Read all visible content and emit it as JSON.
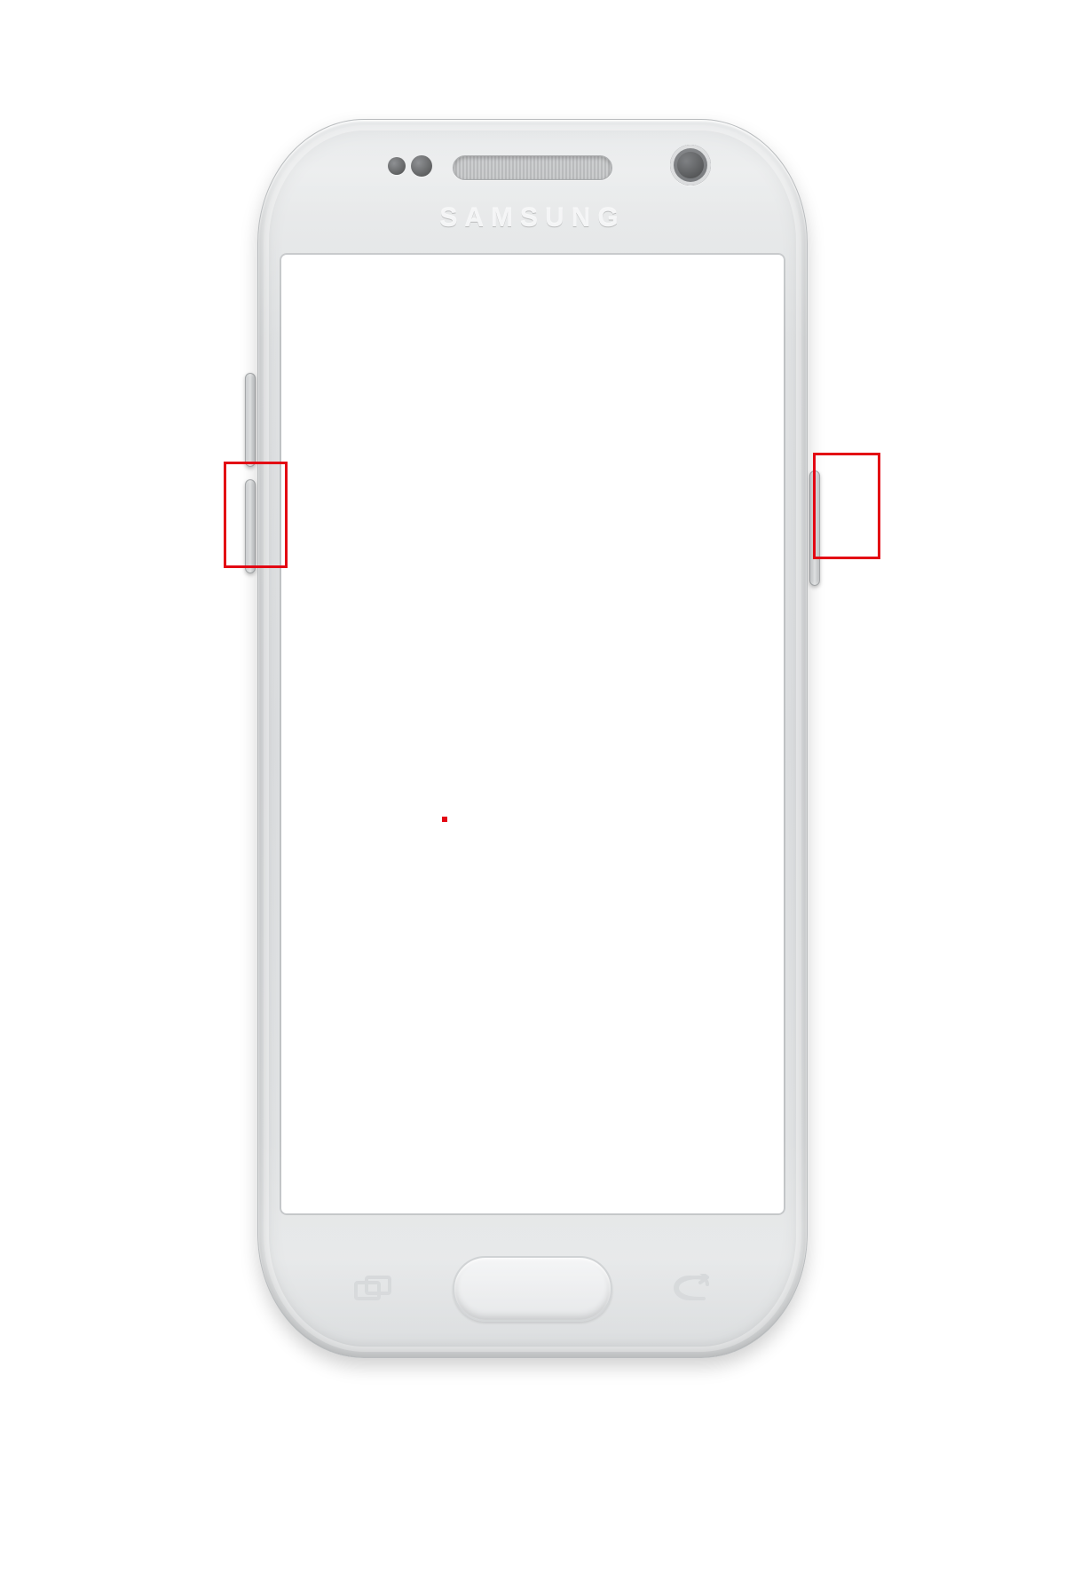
{
  "device": {
    "brand_label": "SAMSUNG",
    "buttons": {
      "volume_up": "Volume up button",
      "volume_down": "Volume down button",
      "power": "Power button",
      "home": "Home button",
      "recents": "Recent apps",
      "back": "Back"
    }
  },
  "annotations": {
    "highlight_left": "Volume-down button highlighted",
    "highlight_right": "Power button highlighted",
    "highlight_color": "#e30613"
  }
}
